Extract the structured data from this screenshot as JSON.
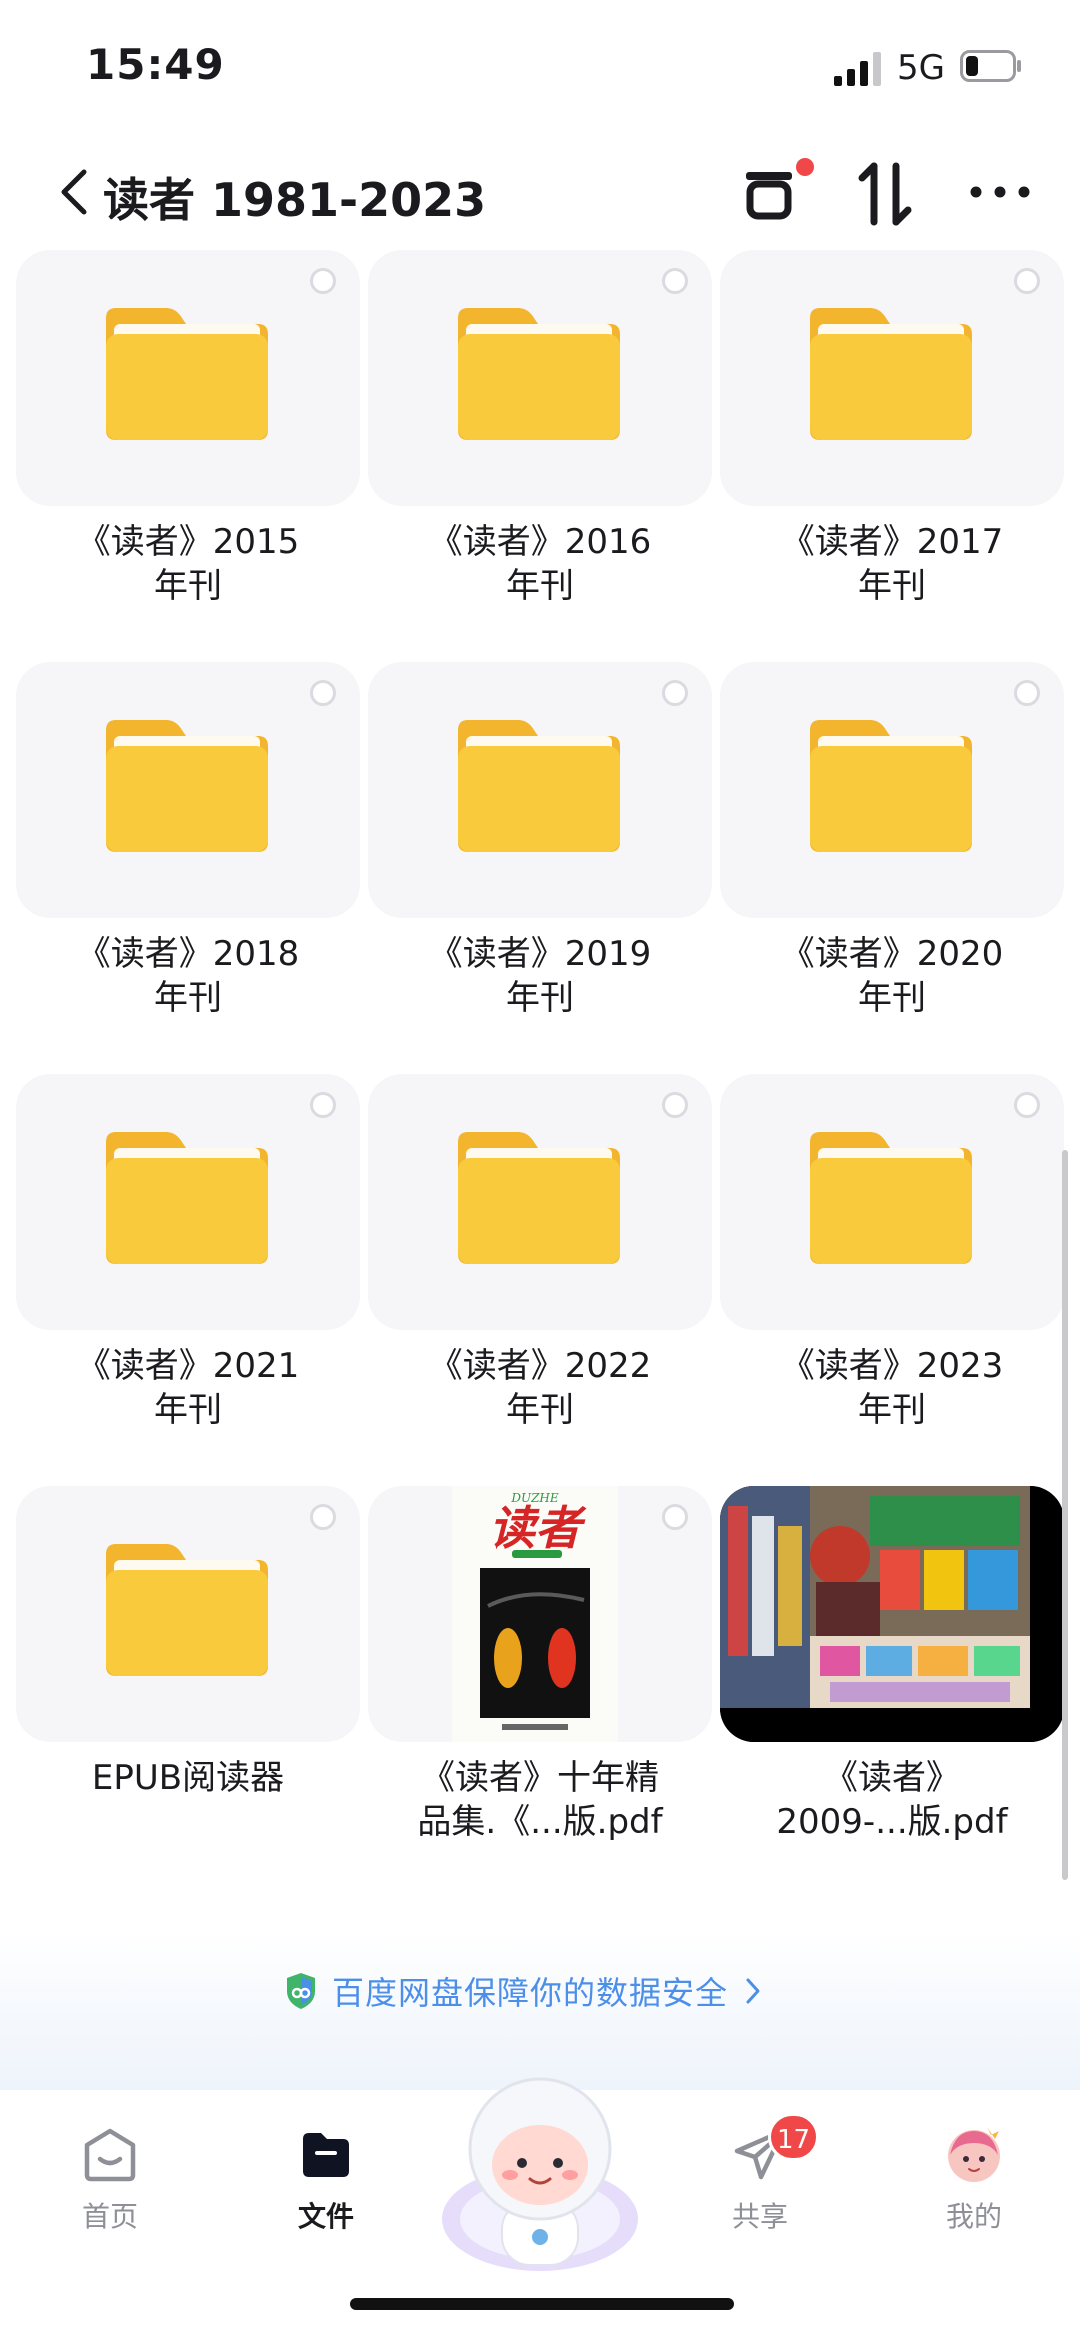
{
  "status_bar": {
    "time": "15:49",
    "network": "5G",
    "battery_level": 0.25
  },
  "header": {
    "back_icon": "chevron-left-icon",
    "title": "读者 1981-2023",
    "actions": [
      "transfer-list-icon",
      "sort-icon",
      "more-icon"
    ]
  },
  "items": [
    {
      "type": "folder",
      "name_line1": "《读者》2015",
      "name_line2": "年刊"
    },
    {
      "type": "folder",
      "name_line1": "《读者》2016",
      "name_line2": "年刊"
    },
    {
      "type": "folder",
      "name_line1": "《读者》2017",
      "name_line2": "年刊"
    },
    {
      "type": "folder",
      "name_line1": "《读者》2018",
      "name_line2": "年刊"
    },
    {
      "type": "folder",
      "name_line1": "《读者》2019",
      "name_line2": "年刊"
    },
    {
      "type": "folder",
      "name_line1": "《读者》2020",
      "name_line2": "年刊"
    },
    {
      "type": "folder",
      "name_line1": "《读者》2021",
      "name_line2": "年刊"
    },
    {
      "type": "folder",
      "name_line1": "《读者》2022",
      "name_line2": "年刊"
    },
    {
      "type": "folder",
      "name_line1": "《读者》2023",
      "name_line2": "年刊"
    },
    {
      "type": "folder",
      "name_line1": "EPUB阅读器",
      "name_line2": ""
    },
    {
      "type": "pdf",
      "name_line1": "《读者》十年精",
      "name_line2": "品集.《...版.pdf",
      "cover_brand": "DUZHE",
      "cover_title": "读者"
    },
    {
      "type": "pdf",
      "name_line1": "《读者》",
      "name_line2": "2009-...版.pdf"
    }
  ],
  "banner": {
    "text": "百度网盘保障你的数据安全"
  },
  "bottom_nav": {
    "items": [
      {
        "label": "首页",
        "icon": "home-icon",
        "active": false
      },
      {
        "label": "文件",
        "icon": "folder-icon",
        "active": true
      },
      {
        "label": "",
        "icon": "assistant-mascot-icon",
        "active": false
      },
      {
        "label": "共享",
        "icon": "share-plane-icon",
        "active": false,
        "badge": "17"
      },
      {
        "label": "我的",
        "icon": "avatar-icon",
        "active": false
      }
    ]
  },
  "colors": {
    "folder": "#f9cb3c",
    "accent": "#4c8fe8",
    "badge": "#f04848"
  }
}
